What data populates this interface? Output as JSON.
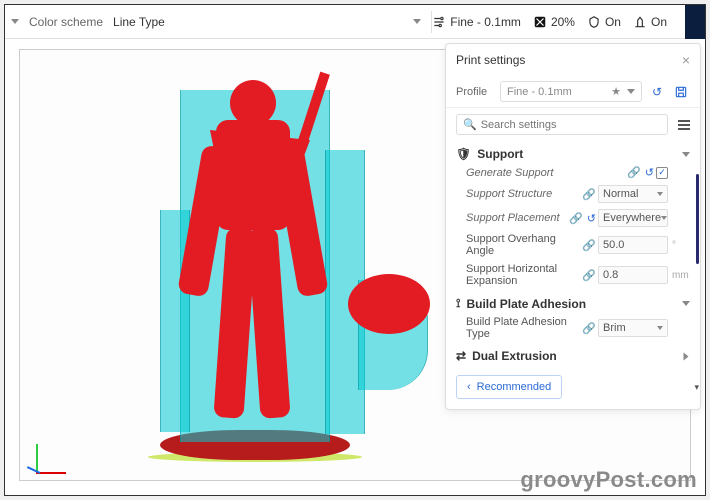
{
  "topbar": {
    "color_scheme_label": "Color scheme",
    "line_type_label": "Line Type",
    "quality_label": "Fine - 0.1mm",
    "infill_pct": "20%",
    "support_on": "On",
    "adhesion_on": "On"
  },
  "panel": {
    "title": "Print settings",
    "profile_label": "Profile",
    "profile_value": "Fine - 0.1mm",
    "search_placeholder": "Search settings",
    "sections": {
      "support": {
        "title": "Support",
        "rows": {
          "generate": {
            "label": "Generate Support",
            "checked": true
          },
          "structure": {
            "label": "Support Structure",
            "value": "Normal"
          },
          "placement": {
            "label": "Support Placement",
            "value": "Everywhere"
          },
          "overhang": {
            "label": "Support Overhang Angle",
            "value": "50.0",
            "unit": "°"
          },
          "hexpansion": {
            "label": "Support Horizontal Expansion",
            "value": "0.8",
            "unit": "mm"
          }
        }
      },
      "adhesion": {
        "title": "Build Plate Adhesion",
        "rows": {
          "type": {
            "label": "Build Plate Adhesion Type",
            "value": "Brim"
          }
        }
      },
      "dual": {
        "title": "Dual Extrusion"
      }
    },
    "recommended": "Recommended"
  },
  "watermark": "groovyPost.com"
}
